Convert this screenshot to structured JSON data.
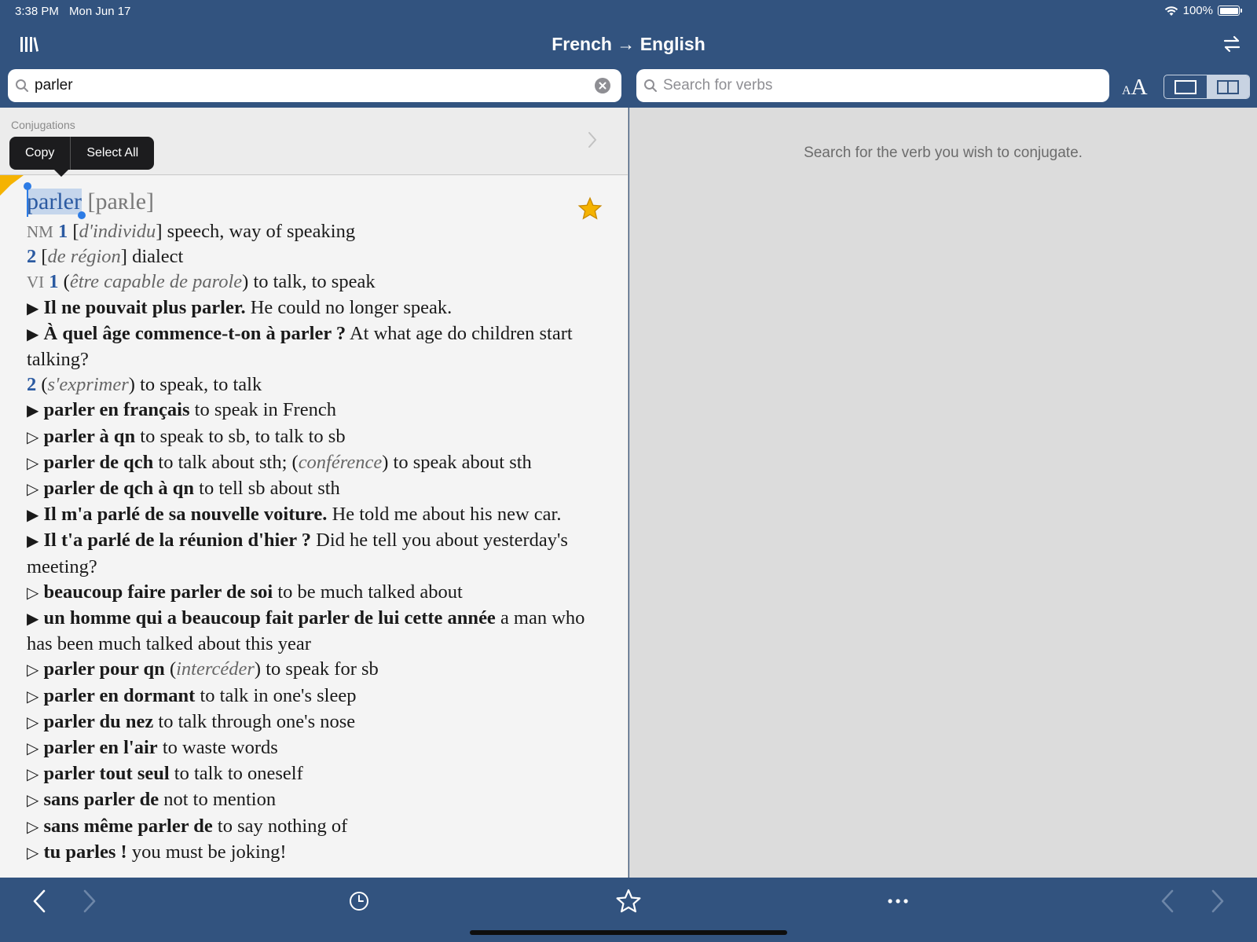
{
  "status_bar": {
    "time": "3:38 PM",
    "date": "Mon Jun 17",
    "battery": "100%"
  },
  "nav": {
    "title": "French → English"
  },
  "search": {
    "query": "parler",
    "verb_placeholder": "Search for verbs"
  },
  "font_size": {
    "small": "A",
    "big": "A"
  },
  "conjugations": {
    "label": "Conjugations"
  },
  "context_menu": {
    "copy": "Copy",
    "select_all": "Select All"
  },
  "right_pane": {
    "hint": "Search for the verb you wish to conjugate."
  },
  "entry": {
    "headword": "parler",
    "phonetic": "[paʀle]",
    "nm": "NM",
    "nm1_num": "1",
    "nm1_gloss": "d'individu",
    "nm1_text": "speech, way of speaking",
    "nm2_num": "2",
    "nm2_gloss": "de région",
    "nm2_text": "dialect",
    "vi": "VI",
    "vi1_num": "1",
    "vi1_gloss": "être capable de parole",
    "vi1_text": "to talk, to speak",
    "ex1_fr": "Il ne pouvait plus parler.",
    "ex1_en": "He could no longer speak.",
    "ex2_fr": "À quel âge commence-t-on à parler ?",
    "ex2_en": "At what age do children start talking?",
    "vi2_num": "2",
    "vi2_gloss": "s'exprimer",
    "vi2_text": "to speak, to talk",
    "ex3_fr": "parler en français",
    "ex3_en": "to speak in French",
    "p1_fr": "parler à qn",
    "p1_en": "to speak to sb, to talk to sb",
    "p2_fr": "parler de qch",
    "p2_en": "to talk about sth;",
    "p2_gloss": "conférence",
    "p2_en2": "to speak about sth",
    "p3_fr": "parler de qch à qn",
    "p3_en": "to tell sb about sth",
    "ex4_fr": "Il m'a parlé de sa nouvelle voiture.",
    "ex4_en": "He told me about his new car.",
    "ex5_fr": "Il t'a parlé de la réunion d'hier ?",
    "ex5_en": "Did he tell you about yesterday's meeting?",
    "p4_fr": "beaucoup faire parler de soi",
    "p4_en": "to be much talked about",
    "ex6_fr": "un homme qui a beaucoup fait parler de lui cette année",
    "ex6_en": "a man who has been much talked about this year",
    "p5_fr": "parler pour qn",
    "p5_gloss": "intercéder",
    "p5_en": "to speak for sb",
    "p6_fr": "parler en dormant",
    "p6_en": "to talk in one's sleep",
    "p7_fr": "parler du nez",
    "p7_en": "to talk through one's nose",
    "p8_fr": "parler en l'air",
    "p8_en": "to waste words",
    "p9_fr": "parler tout seul",
    "p9_en": "to talk to oneself",
    "p10_fr": "sans parler de",
    "p10_en": "not to mention",
    "p11_fr": "sans même parler de",
    "p11_en": "to say nothing of",
    "p12_fr": "tu parles !",
    "p12_en": "you must be joking!"
  },
  "colors": {
    "nav_bg": "#32537f",
    "accent_blue": "#2b5aa1",
    "star": "#f5b301"
  },
  "icons": [
    "library-icon",
    "swap-direction-icon",
    "search-icon",
    "clear-icon",
    "font-size-icon",
    "single-pane-icon",
    "split-pane-icon",
    "chevron-right-icon",
    "star-icon",
    "back-icon",
    "forward-icon",
    "history-icon",
    "favorites-icon",
    "more-icon"
  ]
}
